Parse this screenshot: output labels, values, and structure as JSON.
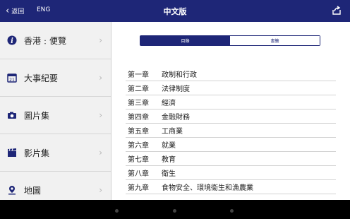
{
  "topbar": {
    "back_label": "返回",
    "lang_label": "ENG",
    "title": "中文版",
    "share_icon": "share-icon"
  },
  "sidebar": {
    "items": [
      {
        "label": "香港﹕便覽",
        "icon": "info-icon"
      },
      {
        "label": "大事紀要",
        "icon": "calendar-icon"
      },
      {
        "label": "圖片集",
        "icon": "camera-icon"
      },
      {
        "label": "影片集",
        "icon": "clapperboard-icon"
      },
      {
        "label": "地圖",
        "icon": "map-pin-icon"
      }
    ]
  },
  "main": {
    "tabs": [
      {
        "label": "目錄",
        "selected": true
      },
      {
        "label": "書籤",
        "selected": false
      }
    ],
    "toc": [
      {
        "num": "第一章",
        "title": "政制和行政"
      },
      {
        "num": "第二章",
        "title": "法律制度"
      },
      {
        "num": "第三章",
        "title": "經濟"
      },
      {
        "num": "第四章",
        "title": "金融財務"
      },
      {
        "num": "第五章",
        "title": "工商業"
      },
      {
        "num": "第六章",
        "title": "就業"
      },
      {
        "num": "第七章",
        "title": "教育"
      },
      {
        "num": "第八章",
        "title": "衛生"
      },
      {
        "num": "第九章",
        "title": "食物安全、環境衞生和漁農業"
      }
    ]
  },
  "colors": {
    "accent": "#1e2677",
    "sidebar_bg": "#f1f1f1"
  }
}
